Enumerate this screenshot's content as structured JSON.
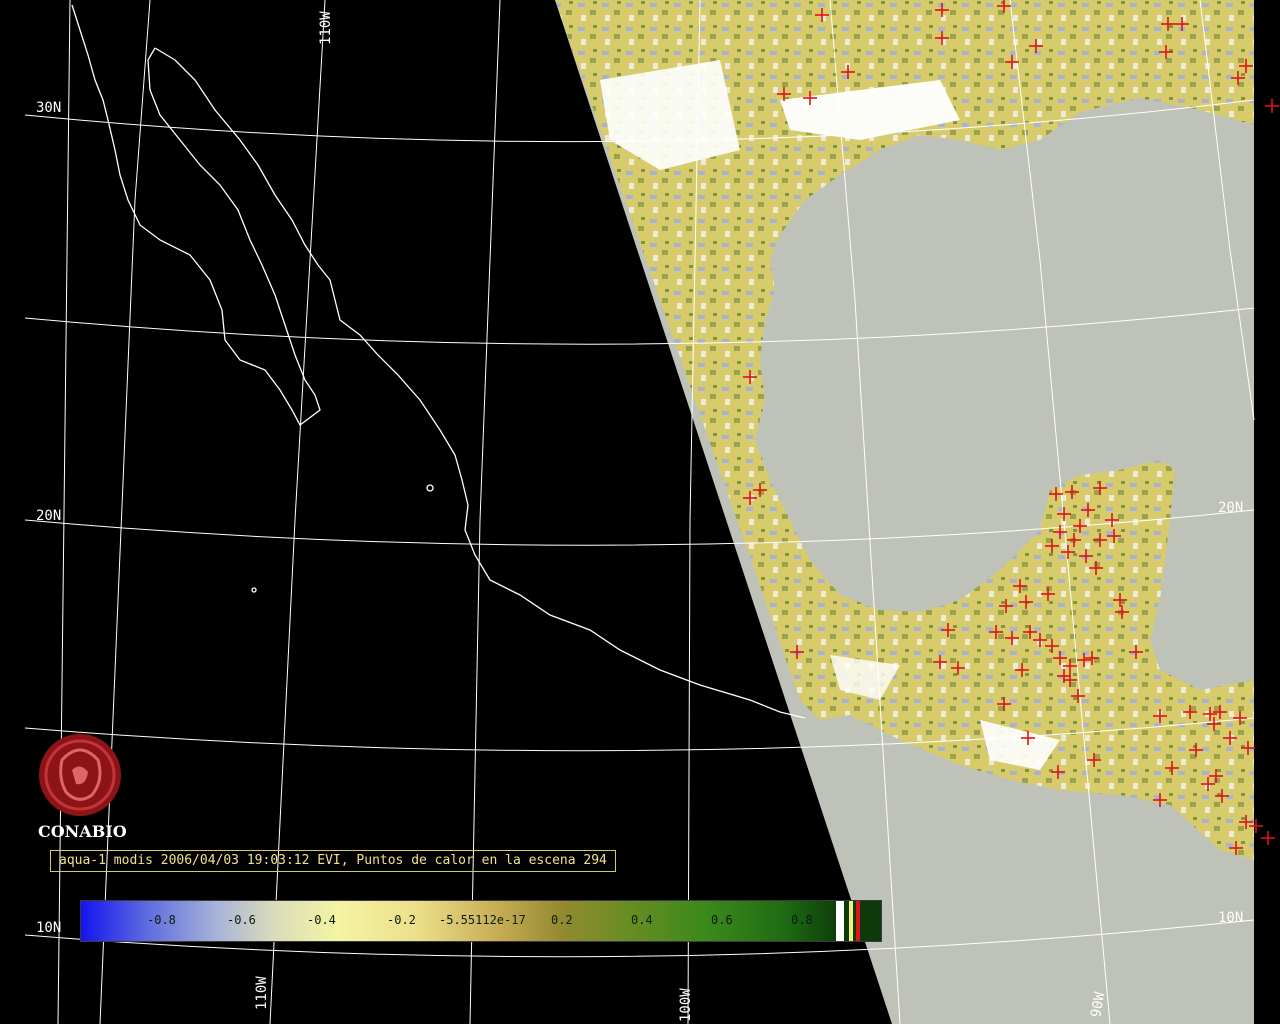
{
  "logo": {
    "name": "CONABIO"
  },
  "caption": "aqua-1 modis 2006/04/03 19:03:12 EVI, Puntos de calor en la escena 294",
  "grid_labels": {
    "lat": [
      "30N",
      "20N",
      "10N",
      "20N",
      "10N"
    ],
    "lon": [
      "110W",
      "110W",
      "100W",
      "90W"
    ]
  },
  "scale": {
    "ticks": [
      "-0.8",
      "-0.6",
      "-0.4",
      "-0.2",
      "-5.55112e-17",
      "0.2",
      "0.4",
      "0.6",
      "0.8"
    ]
  },
  "colors": {
    "background": "#000000",
    "ocean": "#bec2b8",
    "land_swath": "#d7c96a",
    "fire_marker": "#e0121a",
    "grid": "#ffffff",
    "caption": "#f1e38a"
  }
}
